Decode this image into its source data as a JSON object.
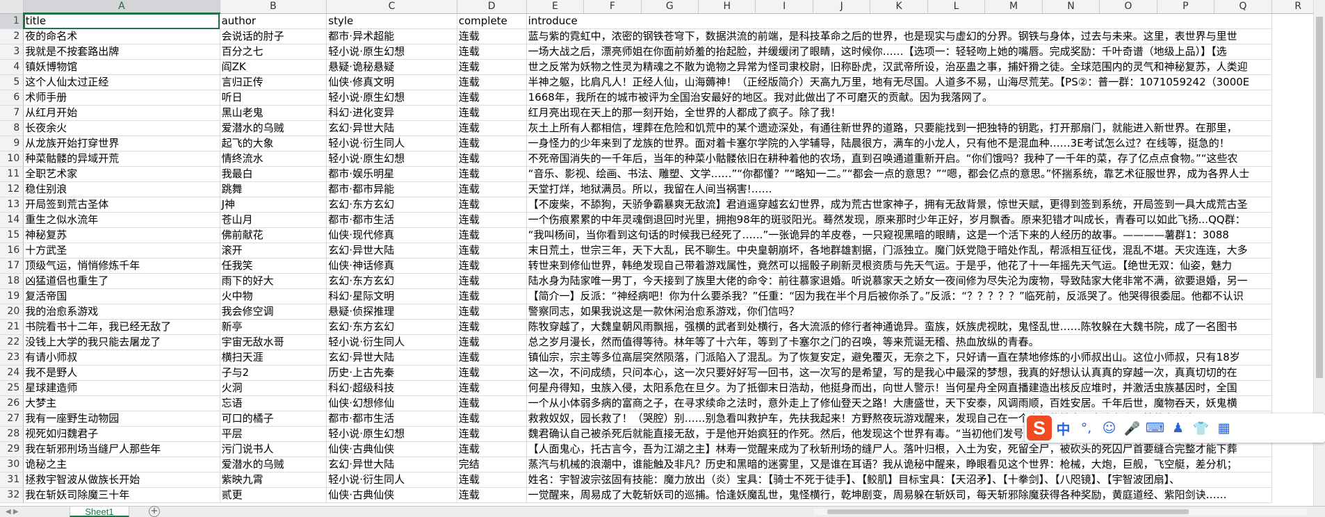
{
  "columns": [
    "A",
    "B",
    "C",
    "D",
    "E",
    "F",
    "G",
    "H",
    "I",
    "J",
    "K",
    "L",
    "M",
    "N",
    "O",
    "P",
    "Q",
    "R"
  ],
  "selected_column": "A",
  "selected_row": 1,
  "rows": [
    {
      "n": "1",
      "title": "title",
      "author": "author",
      "style": "style",
      "complete": "complete",
      "intro": "introduce"
    },
    {
      "n": "2",
      "title": "夜的命名术",
      "author": "会说话的肘子",
      "style": "都市·异术超能",
      "complete": "连载",
      "intro": "蓝与紫的霓虹中，浓密的钢铁苍穹下，数据洪流的前端，是科技革命之后的世界，也是现实与虚幻的分界。钢铁与身体，过去与未来。这里，表世界与里世"
    },
    {
      "n": "3",
      "title": "我就是不按套路出牌",
      "author": "百分之七",
      "style": "轻小说·原生幻想",
      "complete": "连载",
      "intro": "一场大战之后，漂亮师姐在你面前娇羞的抬起脸，并缓缓闭了眼睛，这时候你……【选项一：轻轻吻上她的嘴唇。完成奖励：千叶奇谱（地级上品）】【选"
    },
    {
      "n": "4",
      "title": "镇妖博物馆",
      "author": "阎ZK",
      "style": "悬疑·诡秘悬疑",
      "complete": "连载",
      "intro": "世之反常为妖物之性灵为精魂之不散为诡物之异常为怪司隶校尉，旧称卧虎，汉武帝所设，治巫蛊之事，捕奸猾之徒。全球范围内的灵气和神秘复苏，人类迎"
    },
    {
      "n": "5",
      "title": "这个人仙太过正经",
      "author": "言归正传",
      "style": "仙侠·修真文明",
      "complete": "连载",
      "intro": "半神之躯，比肩凡人！正经人仙，山海薅神！（正经版简介）天高九万里，地有无尽国。人道多不易，山海尽荒芜。【PS②：普一群：1071059242（3000E"
    },
    {
      "n": "6",
      "title": "术师手册",
      "author": "听日",
      "style": "轻小说·原生幻想",
      "complete": "连载",
      "intro": "1668年，我所在的城市被评为全国治安最好的地区。我对此做出了不可磨灭的贡献。因为我落网了。"
    },
    {
      "n": "7",
      "title": "从红月开始",
      "author": "黑山老鬼",
      "style": "科幻·进化变异",
      "complete": "连载",
      "intro": "红月亮出现在天上的那一刻开始，全世界的人都成了疯子。除了我！"
    },
    {
      "n": "8",
      "title": "长夜余火",
      "author": "爱潜水的乌贼",
      "style": "玄幻·异世大陆",
      "complete": "连载",
      "intro": "灰土上所有人都相信，埋葬在危险和饥荒中的某个遗迹深处，有通往新世界的道路，只要能找到一把独特的钥匙，打开那扇门，就能进入新世界。在那里，"
    },
    {
      "n": "9",
      "title": "从龙族开始打穿世界",
      "author": "起飞的大象",
      "style": "轻小说·衍生同人",
      "complete": "连载",
      "intro": "一身怪力的少年来到了龙族的世界。面对着卡塞尔学院的入学辅导，陆晨很方，满车的小龙人，只有他不是混血种……3E考试怎么过？在线等，挺急的！"
    },
    {
      "n": "10",
      "title": "种菜骷髅的异域开荒",
      "author": "情终流水",
      "style": "轻小说·原生幻想",
      "complete": "连载",
      "intro": "不死帝国消失的一千年后，当年的种菜小骷髅依旧在耕种着他的农场，直到召唤通道重新开启。“你们饿吗？我种了一千年的菜，存了亿点点食物。”“这些农"
    },
    {
      "n": "11",
      "title": "全职艺术家",
      "author": "我最白",
      "style": "都市·娱乐明星",
      "complete": "连载",
      "intro": "“音乐、影视、绘画、书法、雕塑、文学……”“你都懂？”“略知一二。”“都会一点的意思？”“嗯，都会亿点的意思。”怀揣系统，靠艺术征服世界，成为各界人士"
    },
    {
      "n": "12",
      "title": "稳住别浪",
      "author": "跳舞",
      "style": "都市·都市异能",
      "complete": "连载",
      "intro": "天堂打烊，地狱满员。所以，我留在人间当祸害!……"
    },
    {
      "n": "13",
      "title": "开局签到荒古圣体",
      "author": "J神",
      "style": "玄幻·东方玄幻",
      "complete": "连载",
      "intro": "【不废柴，不舔狗，天骄争霸暴爽无敌流】君逍遥穿越玄幻世界，成为荒古世家神子，拥有无敌背景，惊世天赋，更得到签到系统，开局签到一具大成荒古圣"
    },
    {
      "n": "14",
      "title": "重生之似水流年",
      "author": "苍山月",
      "style": "都市·都市生活",
      "complete": "连载",
      "intro": "一个伤痕累累的中年灵魂倒退回时光里，拥抱98年的斑驳阳光。蓦然发现，原来那时少年正好，岁月飘香。原来犯错才叫成长，青春可以如此飞扬...QQ群："
    },
    {
      "n": "15",
      "title": "神秘复苏",
      "author": "佛前献花",
      "style": "仙侠·现代修真",
      "complete": "连载",
      "intro": "“我叫杨间，当你看到这句话的时候我已经死了……”一张诡异的羊皮卷，一只窥视黑暗的眼睛，这是一个活下来的人经历的故事。————薯群1：3088"
    },
    {
      "n": "16",
      "title": "十方武圣",
      "author": "滚开",
      "style": "玄幻·异世大陆",
      "complete": "连载",
      "intro": "末日荒土，世宗三年，天下大乱，民不聊生。中央皇朝崩坏，各地群雄割据，门派独立。魔门妖党隐于暗处作乱，帮派相互征伐，混乱不堪。天灾连连，大多"
    },
    {
      "n": "17",
      "title": "顶级气运，悄悄修炼千年",
      "author": "任我笑",
      "style": "仙侠·神话修真",
      "complete": "连载",
      "intro": "转世来到修仙世界，韩绝发现自己带着游戏属性，竟然可以摇骰子刷新灵根资质与先天气运。于是乎，他花了十一年摇先天气运。【绝世无双：仙姿，魅力"
    },
    {
      "n": "18",
      "title": "凶猛道侣也重生了",
      "author": "雨下的好大",
      "style": "玄幻·东方玄幻",
      "complete": "连载",
      "intro": "陆水身为陆家唯一男丁，今天接到了族里大佬的命令：前往慕家退婚。听说慕家天之娇女一夜间修为尽失沦为废物，导致陆家大佬非常不满，欲要退婚，另一"
    },
    {
      "n": "19",
      "title": "复活帝国",
      "author": "火中物",
      "style": "科幻·星际文明",
      "complete": "连载",
      "intro": "【简介一】反派：“神经病吧！你为什么要杀我？”任重：“因为我在半个月后被你杀了。”反派：“？？？？？”临死前，反派哭了。他哭得很委屈。他都不认识"
    },
    {
      "n": "20",
      "title": "我的治愈系游戏",
      "author": "我会修空调",
      "style": "悬疑·侦探推理",
      "complete": "连载",
      "intro": "警察同志，如果我说这是一款休闲治愈系游戏，你们信吗？"
    },
    {
      "n": "21",
      "title": "书院看书十二年，我已经无敌了",
      "author": "新亭",
      "style": "玄幻·东方玄幻",
      "complete": "连载",
      "intro": "陈牧穿越了，大魏皇朝风雨飘摇，强横的武者到处横行，各大流派的修行者神通诡异。蛮族，妖族虎视眈，鬼怪乱世……陈牧躲在大魏书院，成了一名图书"
    },
    {
      "n": "22",
      "title": "没钱上大学的我只能去屠龙了",
      "author": "宇宙无敌水哥",
      "style": "轻小说·衍生同人",
      "complete": "连载",
      "intro": "总之岁月漫长，然而值得等待。林年等了十六年，等到了卡塞尔之门的召唤，等来荒诞无稽、热血放纵的青春。"
    },
    {
      "n": "23",
      "title": "有请小师叔",
      "author": "横扫天涯",
      "style": "玄幻·异世大陆",
      "complete": "连载",
      "intro": "镇仙宗，宗主等多位高层突然陨落，门派陷入了混乱。为了恢复安定，避免覆灭，无奈之下，只好请一直在禁地修炼的小师叔出山。这位小师叔，只有18岁"
    },
    {
      "n": "24",
      "title": "我不是野人",
      "author": "子与2",
      "style": "历史·上古先秦",
      "complete": "连载",
      "intro": "这一次，不问成绩，只问本心，这一次只要好好写一回书，这一次写的是希望，写的是我心中最深的梦想，我真的好想认认真真的穿越一次，真真切切的在"
    },
    {
      "n": "25",
      "title": "星球建造师",
      "author": "火洞",
      "style": "科幻·超级科技",
      "complete": "连载",
      "intro": "何星舟得知，虫族入侵，太阳系危在旦夕。为了抵御末日浩劫，他挺身而出，向世人警示！当何星舟全网直播建造出核反应堆时，并激活虫族基因时，全国"
    },
    {
      "n": "26",
      "title": "大梦主",
      "author": "忘语",
      "style": "仙侠·幻想修仙",
      "complete": "连载",
      "intro": "一个从小体弱多病的富商之子，在寻求续命之法时，意外走上了修仙登天之路！大唐盛世，天下安泰，风调雨顺，百姓安居。千年后世，魔物吞天，妖鬼横"
    },
    {
      "n": "27",
      "title": "我有一座野生动物园",
      "author": "可口的橘子",
      "style": "都市·都市生活",
      "complete": "连载",
      "intro": "救救奴奴，园长救了！（哭腔）别……别急看叫救护车，先扶我起来！方野熬夜玩游戏醒来，发现自己在一个奇怪的地方，身边有个灵性的东北虎，凶"
    },
    {
      "n": "28",
      "title": "视死如归魏君子",
      "author": "平层",
      "style": "轻小说·原生幻想",
      "complete": "连载",
      "intro": "魏君确认自己被杀死后就能直接无敌，于是他开始疯狂的作死。然后，他发现这个世界有毒。“当初他们发号了钢笔之主角叫作，满嘴义武包括旅管对仙人"
    },
    {
      "n": "29",
      "title": "我在斩邪刑场当缝尸人那些年",
      "author": "污门说书人",
      "style": "仙侠·古典仙侠",
      "complete": "连载",
      "intro": "【人面鬼心，托古言今，吾为江湖之主】林寿一觉醒来成为了秋斩刑场的缝尸人。落叶归根，入土为安，死留全尸，被砍头的死囚尸首要缝合完整才能下葬"
    },
    {
      "n": "30",
      "title": "诡秘之主",
      "author": "爱潜水的乌贼",
      "style": "玄幻·异世大陆",
      "complete": "完结",
      "intro": "蒸汽与机械的浪潮中，谁能触及非凡？历史和黑暗的迷雾里，又是谁在耳语？我从诡秘中醒来，睁眼看见这个世界：枪械，大炮，巨舰，飞空艇，差分机；"
    },
    {
      "n": "31",
      "title": "拯救宇智波从做族长开始",
      "author": "紫映九霄",
      "style": "轻小说·衍生同人",
      "complete": "连载",
      "intro": "姓名：宇智波宗弦固有技能：魔力放出（炎）宝具：【骑士不死于徒手】、【鲛肌】目标宝具：【天沼矛】、【十拳剑】、【八咫镜】、【宇智波团扇】、"
    },
    {
      "n": "32",
      "title": "我在斩妖司除魔三十年",
      "author": "贰更",
      "style": "仙侠·古典仙侠",
      "complete": "连载",
      "intro": "一觉醒来，周易成了大乾斩妖司的巡捕。恰逢妖魔乱世，鬼怪横行，乾坤剧变，周易躲在斩妖司，每天斩邪除魔获得各种奖励，黄庭道经、紫阳剑诀……"
    }
  ],
  "sheet_tab": "Sheet1",
  "ime": {
    "logo": "S",
    "items": [
      {
        "label": "中",
        "icon": ""
      },
      {
        "label": "°,",
        "icon": ""
      },
      {
        "label": "☺",
        "icon": "emoji-icon"
      },
      {
        "label": "🎤",
        "icon": "microphone-icon"
      },
      {
        "label": "⌨",
        "icon": "keyboard-icon"
      },
      {
        "label": "♟",
        "icon": "user-icon"
      },
      {
        "label": "👕",
        "icon": "skin-icon"
      },
      {
        "label": "▦",
        "icon": "toolbox-icon"
      }
    ]
  }
}
